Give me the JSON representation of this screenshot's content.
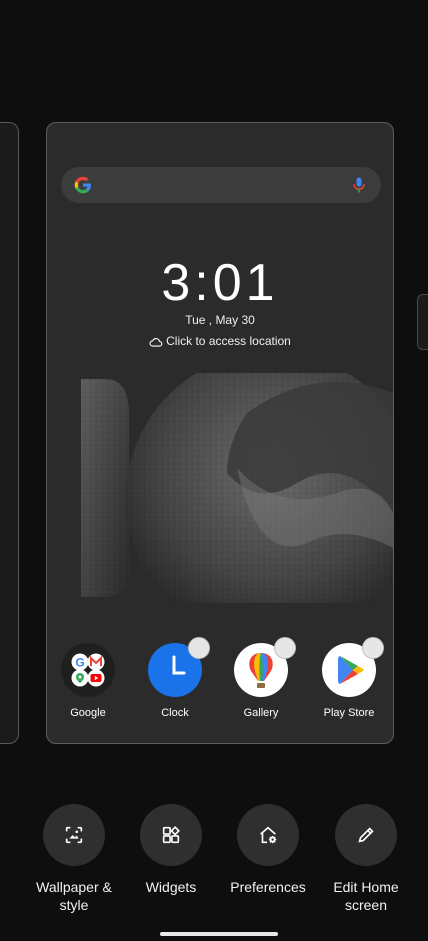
{
  "clock": {
    "time": "3:01",
    "date": "Tue , May 30",
    "location_prompt": "Click to access location"
  },
  "apps": [
    {
      "label": "Google",
      "icon": "google-folder-icon"
    },
    {
      "label": "Clock",
      "icon": "clock-icon"
    },
    {
      "label": "Gallery",
      "icon": "gallery-icon"
    },
    {
      "label": "Play Store",
      "icon": "play-store-icon"
    }
  ],
  "actions": {
    "wallpaper": {
      "line1": "Wallpaper &",
      "line2": "style",
      "icon": "wallpaper-icon"
    },
    "widgets": {
      "label": "Widgets",
      "icon": "widgets-icon"
    },
    "preferences": {
      "label": "Preferences",
      "icon": "home-settings-icon"
    },
    "edit_home": {
      "line1": "Edit Home",
      "line2": "screen",
      "icon": "pencil-icon"
    }
  },
  "colors": {
    "background": "#0e0e0e",
    "card": "#2b2b2b",
    "action_button": "#2f2f2f",
    "clock_blue": "#1a73e8"
  }
}
